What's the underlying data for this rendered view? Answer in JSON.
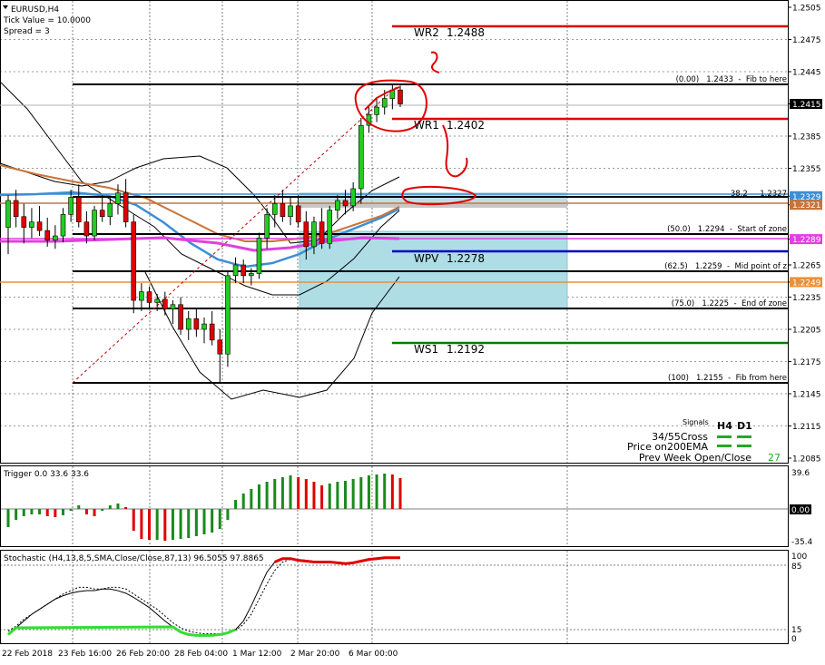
{
  "header": {
    "symbol": "EURUSD,H4",
    "tick_value": "Tick Value = 10.0000",
    "spread": "Spread = 3"
  },
  "price_axis": {
    "labels": [
      "1.2505",
      "1.2475",
      "1.2445",
      "1.2415",
      "1.2385",
      "1.2355",
      "1.2329",
      "1.2321",
      "1.2289",
      "1.2265",
      "1.2249",
      "1.2235",
      "1.2205",
      "1.2175",
      "1.2145",
      "1.2115",
      "1.2085"
    ],
    "highlight": {
      "1.2415": {
        "bg": "#000000",
        "fg": "#ffffff"
      },
      "1.2329": {
        "bg": "#3a8fd6",
        "fg": "#ffffff"
      },
      "1.2321": {
        "bg": "#c8733a",
        "fg": "#ffffff"
      },
      "1.2289": {
        "bg": "#e040e0",
        "fg": "#ffffff"
      },
      "1.2249": {
        "bg": "#e8903a",
        "fg": "#ffffff"
      }
    }
  },
  "time_axis": {
    "labels": [
      "22 Feb 2018",
      "23 Feb 16:00",
      "26 Feb 20:00",
      "28 Feb 04:00",
      "1 Mar 12:00",
      "2 Mar 20:00",
      "6 Mar 00:00"
    ]
  },
  "levels": {
    "pivots": [
      {
        "label": "WR2",
        "value": "1.2488",
        "color": "#e00000"
      },
      {
        "label": "WR1",
        "value": "1.2402",
        "color": "#e00000"
      },
      {
        "label": "WPV",
        "value": "1.2278",
        "color": "#0000c0"
      },
      {
        "label": "WS1",
        "value": "1.2192",
        "color": "#008000"
      }
    ],
    "fib": [
      {
        "text": "(0.00)   1.2433  -  Fib to here"
      },
      {
        "text": "38.2     1.2327"
      },
      {
        "text": "(50.0)   1.2294  -  Start of zone"
      },
      {
        "text": "(62.5)   1.2259  -  Mid point of z"
      },
      {
        "text": "(75.0)   1.2225  -  End of zone"
      },
      {
        "text": "(100)   1.2155  -  Fib from here"
      }
    ]
  },
  "signals": {
    "title": "Signals",
    "col_h4": "H4",
    "col_d1": "D1",
    "row1": "34/55Cross",
    "row2": "Price on200EMA",
    "row3": "Prev Week Open/Close",
    "row3_value": "27"
  },
  "trigger": {
    "title": "Trigger 0.0 33.6 33.6",
    "axis": [
      "39.6",
      "0.00",
      "-35.4"
    ]
  },
  "stochastic": {
    "title": "Stochastic (H4,13,8,5,SMA,Close/Close,87,13) 96.5055 97.8865",
    "axis": [
      "100",
      "85",
      "15",
      "0"
    ]
  },
  "chart_data": {
    "type": "candlestick",
    "symbol": "EURUSD",
    "timeframe": "H4",
    "ylim": [
      1.208,
      1.251
    ],
    "x_ticks": [
      "22 Feb 2018",
      "23 Feb 16:00",
      "26 Feb 20:00",
      "28 Feb 04:00",
      "1 Mar 12:00",
      "2 Mar 20:00",
      "6 Mar 00:00"
    ],
    "candles": [
      {
        "o": 1.23,
        "h": 1.233,
        "l": 1.2275,
        "c": 1.2325
      },
      {
        "o": 1.2325,
        "h": 1.2335,
        "l": 1.23,
        "c": 1.231
      },
      {
        "o": 1.231,
        "h": 1.2322,
        "l": 1.2285,
        "c": 1.23
      },
      {
        "o": 1.23,
        "h": 1.2318,
        "l": 1.229,
        "c": 1.2305
      },
      {
        "o": 1.2305,
        "h": 1.232,
        "l": 1.2292,
        "c": 1.2297
      },
      {
        "o": 1.2297,
        "h": 1.2309,
        "l": 1.2282,
        "c": 1.2288
      },
      {
        "o": 1.2288,
        "h": 1.2302,
        "l": 1.228,
        "c": 1.2292
      },
      {
        "o": 1.2292,
        "h": 1.2318,
        "l": 1.2286,
        "c": 1.2312
      },
      {
        "o": 1.2312,
        "h": 1.2335,
        "l": 1.2305,
        "c": 1.2328
      },
      {
        "o": 1.2328,
        "h": 1.234,
        "l": 1.23,
        "c": 1.2305
      },
      {
        "o": 1.2305,
        "h": 1.2315,
        "l": 1.2285,
        "c": 1.2292
      },
      {
        "o": 1.2292,
        "h": 1.232,
        "l": 1.2288,
        "c": 1.2316
      },
      {
        "o": 1.2316,
        "h": 1.233,
        "l": 1.2305,
        "c": 1.231
      },
      {
        "o": 1.231,
        "h": 1.2328,
        "l": 1.2302,
        "c": 1.2322
      },
      {
        "o": 1.2322,
        "h": 1.234,
        "l": 1.2312,
        "c": 1.2332
      },
      {
        "o": 1.2332,
        "h": 1.2345,
        "l": 1.23,
        "c": 1.2305
      },
      {
        "o": 1.2305,
        "h": 1.2312,
        "l": 1.222,
        "c": 1.2232
      },
      {
        "o": 1.2232,
        "h": 1.2248,
        "l": 1.2222,
        "c": 1.224
      },
      {
        "o": 1.224,
        "h": 1.2245,
        "l": 1.2225,
        "c": 1.223
      },
      {
        "o": 1.223,
        "h": 1.2238,
        "l": 1.2222,
        "c": 1.2233
      },
      {
        "o": 1.2233,
        "h": 1.224,
        "l": 1.2218,
        "c": 1.2224
      },
      {
        "o": 1.2224,
        "h": 1.2232,
        "l": 1.221,
        "c": 1.2228
      },
      {
        "o": 1.2228,
        "h": 1.2235,
        "l": 1.22,
        "c": 1.2205
      },
      {
        "o": 1.2205,
        "h": 1.2222,
        "l": 1.2195,
        "c": 1.2215
      },
      {
        "o": 1.2215,
        "h": 1.2225,
        "l": 1.2198,
        "c": 1.2205
      },
      {
        "o": 1.2205,
        "h": 1.2216,
        "l": 1.2192,
        "c": 1.221
      },
      {
        "o": 1.221,
        "h": 1.2222,
        "l": 1.219,
        "c": 1.2195
      },
      {
        "o": 1.2195,
        "h": 1.2205,
        "l": 1.2155,
        "c": 1.2182
      },
      {
        "o": 1.2182,
        "h": 1.226,
        "l": 1.217,
        "c": 1.2255
      },
      {
        "o": 1.2255,
        "h": 1.2272,
        "l": 1.2248,
        "c": 1.2265
      },
      {
        "o": 1.2265,
        "h": 1.227,
        "l": 1.2248,
        "c": 1.2255
      },
      {
        "o": 1.2255,
        "h": 1.2262,
        "l": 1.2246,
        "c": 1.2257
      },
      {
        "o": 1.2257,
        "h": 1.2295,
        "l": 1.2252,
        "c": 1.229
      },
      {
        "o": 1.229,
        "h": 1.2318,
        "l": 1.228,
        "c": 1.2312
      },
      {
        "o": 1.2312,
        "h": 1.233,
        "l": 1.23,
        "c": 1.2322
      },
      {
        "o": 1.2322,
        "h": 1.2335,
        "l": 1.2305,
        "c": 1.231
      },
      {
        "o": 1.231,
        "h": 1.2328,
        "l": 1.2302,
        "c": 1.232
      },
      {
        "o": 1.232,
        "h": 1.233,
        "l": 1.23,
        "c": 1.2305
      },
      {
        "o": 1.2305,
        "h": 1.2315,
        "l": 1.227,
        "c": 1.2282
      },
      {
        "o": 1.2282,
        "h": 1.231,
        "l": 1.2275,
        "c": 1.2305
      },
      {
        "o": 1.2305,
        "h": 1.2318,
        "l": 1.228,
        "c": 1.2285
      },
      {
        "o": 1.2285,
        "h": 1.232,
        "l": 1.228,
        "c": 1.2316
      },
      {
        "o": 1.2316,
        "h": 1.233,
        "l": 1.2308,
        "c": 1.2325
      },
      {
        "o": 1.2325,
        "h": 1.2335,
        "l": 1.2312,
        "c": 1.232
      },
      {
        "o": 1.232,
        "h": 1.2342,
        "l": 1.2315,
        "c": 1.2336
      },
      {
        "o": 1.2336,
        "h": 1.2402,
        "l": 1.2322,
        "c": 1.2395
      },
      {
        "o": 1.2395,
        "h": 1.2412,
        "l": 1.2388,
        "c": 1.2405
      },
      {
        "o": 1.2405,
        "h": 1.242,
        "l": 1.2398,
        "c": 1.2412
      },
      {
        "o": 1.2412,
        "h": 1.2428,
        "l": 1.2405,
        "c": 1.242
      },
      {
        "o": 1.242,
        "h": 1.2433,
        "l": 1.241,
        "c": 1.2428
      },
      {
        "o": 1.2428,
        "h": 1.2432,
        "l": 1.2412,
        "c": 1.2415
      }
    ],
    "trigger_histogram": [
      -20,
      -12,
      -8,
      -6,
      -6,
      -8,
      -9,
      -7,
      -2,
      4,
      -6,
      -8,
      -2,
      4,
      6,
      2,
      -24,
      -33,
      -34,
      -34,
      -35,
      -34,
      -33,
      -32,
      -30,
      -28,
      -26,
      -22,
      -12,
      10,
      17,
      22,
      27,
      30,
      33,
      35,
      37,
      35,
      33,
      30,
      26,
      28,
      30,
      31,
      33,
      35,
      37,
      38,
      39,
      38,
      34
    ],
    "stochastic_main": [
      6,
      14,
      22,
      30,
      36,
      42,
      48,
      52,
      55,
      57,
      58,
      58,
      60,
      60,
      58,
      55,
      50,
      44,
      38,
      30,
      22,
      15,
      9,
      6,
      5,
      5,
      5,
      6,
      8,
      12,
      22,
      40,
      60,
      80,
      92,
      96,
      96,
      94,
      93,
      92,
      92,
      92,
      91,
      90,
      91,
      93,
      95,
      96,
      97,
      97,
      97
    ],
    "stochastic_signal": [
      10,
      16,
      24,
      30,
      36,
      42,
      48,
      54,
      58,
      62,
      62,
      60,
      60,
      62,
      62,
      60,
      54,
      48,
      42,
      36,
      28,
      20,
      14,
      10,
      8,
      7,
      7,
      7,
      8,
      11,
      18,
      30,
      48,
      66,
      82,
      92,
      95,
      95,
      94,
      93,
      92,
      92,
      92,
      91,
      91,
      92,
      94,
      95,
      96,
      97,
      98
    ]
  }
}
